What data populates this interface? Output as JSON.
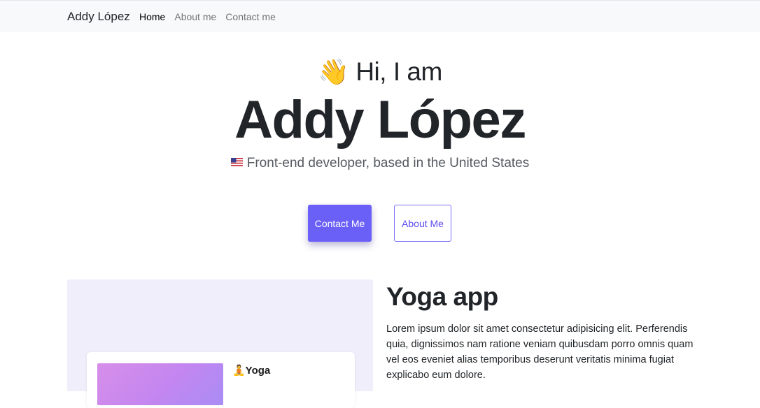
{
  "navbar": {
    "brand": "Addy López",
    "links": [
      "Home",
      "About me",
      "Contact me"
    ],
    "active": "Home"
  },
  "hero": {
    "greeting_emoji": "👋",
    "greeting": "Hi, I am",
    "name": "Addy López",
    "subtitle": "Front-end developer, based in the United States"
  },
  "buttons": {
    "contact_label": "Contact Me",
    "about_label": "About Me"
  },
  "project": {
    "title": "Yoga app",
    "description": "Lorem ipsum dolor sit amet consectetur adipisicing elit. Perferendis quia, dignissimos nam ratione veniam quibusdam porro omnis quam vel eos eveniet alias temporibus deserunt veritatis minima fugiat explicabo eum dolore.",
    "preview_app_title": "🧘Yoga"
  },
  "colors": {
    "accent": "#6a5ff7",
    "navbar_bg": "#f8f9fa",
    "preview_bg": "#f1eefb"
  }
}
